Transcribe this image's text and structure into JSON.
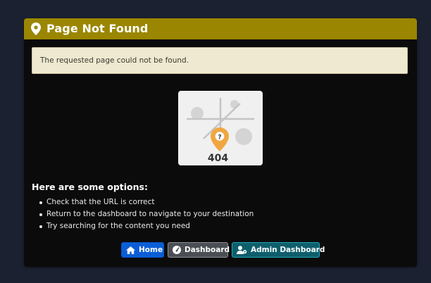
{
  "header": {
    "title": "Page Not Found",
    "icon": "map-marker-icon",
    "color": "#9a8600"
  },
  "alert": {
    "message": "The requested page could not be found."
  },
  "illustration": {
    "code": "404",
    "pin_symbol": "?",
    "pin_color": "#f0a742"
  },
  "options": {
    "heading": "Here are some options:",
    "items": [
      "Check that the URL is correct",
      "Return to the dashboard to navigate to your destination",
      "Try searching for the content you need"
    ]
  },
  "buttons": {
    "home": {
      "label": "Home",
      "icon": "home-icon",
      "color": "#0b5ed7"
    },
    "dashboard": {
      "label": "Dashboard",
      "icon": "dashboard-gauge-icon",
      "color": "#4b4f55"
    },
    "admin": {
      "label": "Admin Dashboard",
      "icon": "user-gear-icon",
      "color": "#0e5f6c"
    }
  }
}
